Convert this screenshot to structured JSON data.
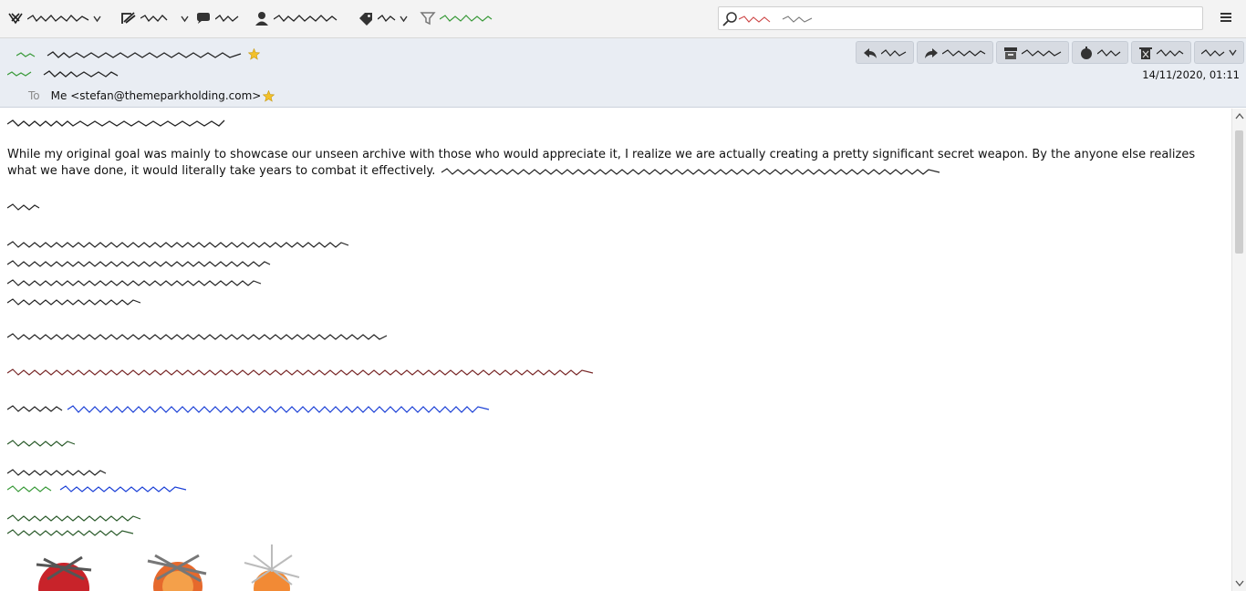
{
  "toolbar": {
    "items": [
      {
        "name": "get-messages",
        "icon": "download-arrow-icon",
        "has_menu": true
      },
      {
        "name": "write",
        "icon": "pencil-icon",
        "has_menu": true
      },
      {
        "name": "chat",
        "icon": "chat-bubble-icon",
        "has_menu": false
      },
      {
        "name": "address-book",
        "icon": "person-icon",
        "has_menu": false
      },
      {
        "name": "tag",
        "icon": "tag-icon",
        "has_menu": true
      },
      {
        "name": "quick-filter",
        "icon": "funnel-icon",
        "has_menu": false
      }
    ],
    "search_placeholder": ""
  },
  "header": {
    "to_label": "To",
    "to_value": "Me <stefan@themeparkholding.com>",
    "date": "14/11/2020, 01:11",
    "actions": [
      {
        "name": "reply",
        "icon": "reply-icon"
      },
      {
        "name": "forward",
        "icon": "forward-icon"
      },
      {
        "name": "archive",
        "icon": "archive-icon"
      },
      {
        "name": "junk",
        "icon": "junk-icon"
      },
      {
        "name": "delete",
        "icon": "delete-icon"
      },
      {
        "name": "more",
        "icon": "more-icon",
        "has_menu": true
      }
    ]
  },
  "message": {
    "visible_paragraph_start": "While my original goal was mainly to showcase our unseen archive with those who would appreciate it, I realize we are actually creating a pretty significant secret weapon. By the anyone else realizes what we have done, it would literally take years to combat it effectively."
  },
  "colors": {
    "toolbar_bg": "#f3f3f3",
    "header_bg": "#e9edf3",
    "link_blue": "#1a3fd6",
    "star_yellow": "#f2c02a",
    "scribble_dark": "#222222"
  }
}
